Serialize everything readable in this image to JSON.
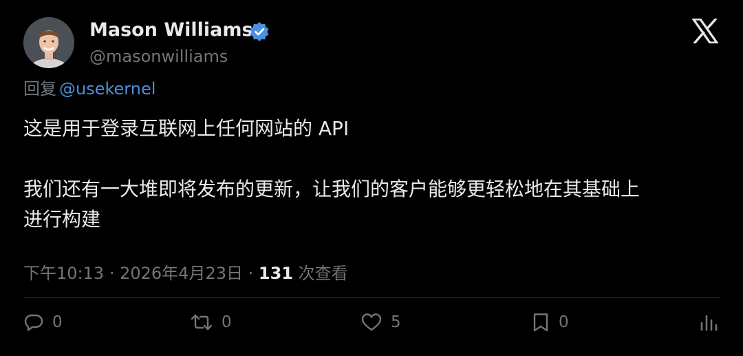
{
  "author": {
    "name": "Mason Williams",
    "handle": "@masonwilliams",
    "verified": true
  },
  "reply_to": {
    "prefix": "回复",
    "mention": "@usekernel"
  },
  "tweet": {
    "paragraphs": [
      "这是用于登录互联网上任何网站的 API",
      "我们还有一大堆即将发布的更新，让我们的客户能够更轻松地在其基础上",
      "进行构建"
    ]
  },
  "meta": {
    "time": "下午10:13",
    "separator": "·",
    "date": "2026年4月23日",
    "views_count": "131",
    "views_label": "次查看"
  },
  "actions": {
    "reply_count": "0",
    "repost_count": "0",
    "like_count": "5",
    "bookmark_count": "0"
  },
  "icons": {
    "platform": "x-logo-icon",
    "verified": "verified-badge-icon",
    "reply": "reply-icon",
    "repost": "repost-icon",
    "like": "heart-icon",
    "bookmark": "bookmark-icon",
    "stats": "stats-icon"
  },
  "colors": {
    "background": "#000000",
    "text_primary": "#e7e9ea",
    "text_secondary": "#71767b",
    "link": "#4b90dd",
    "verified": "#4b90dd",
    "divider": "#2f3336"
  }
}
